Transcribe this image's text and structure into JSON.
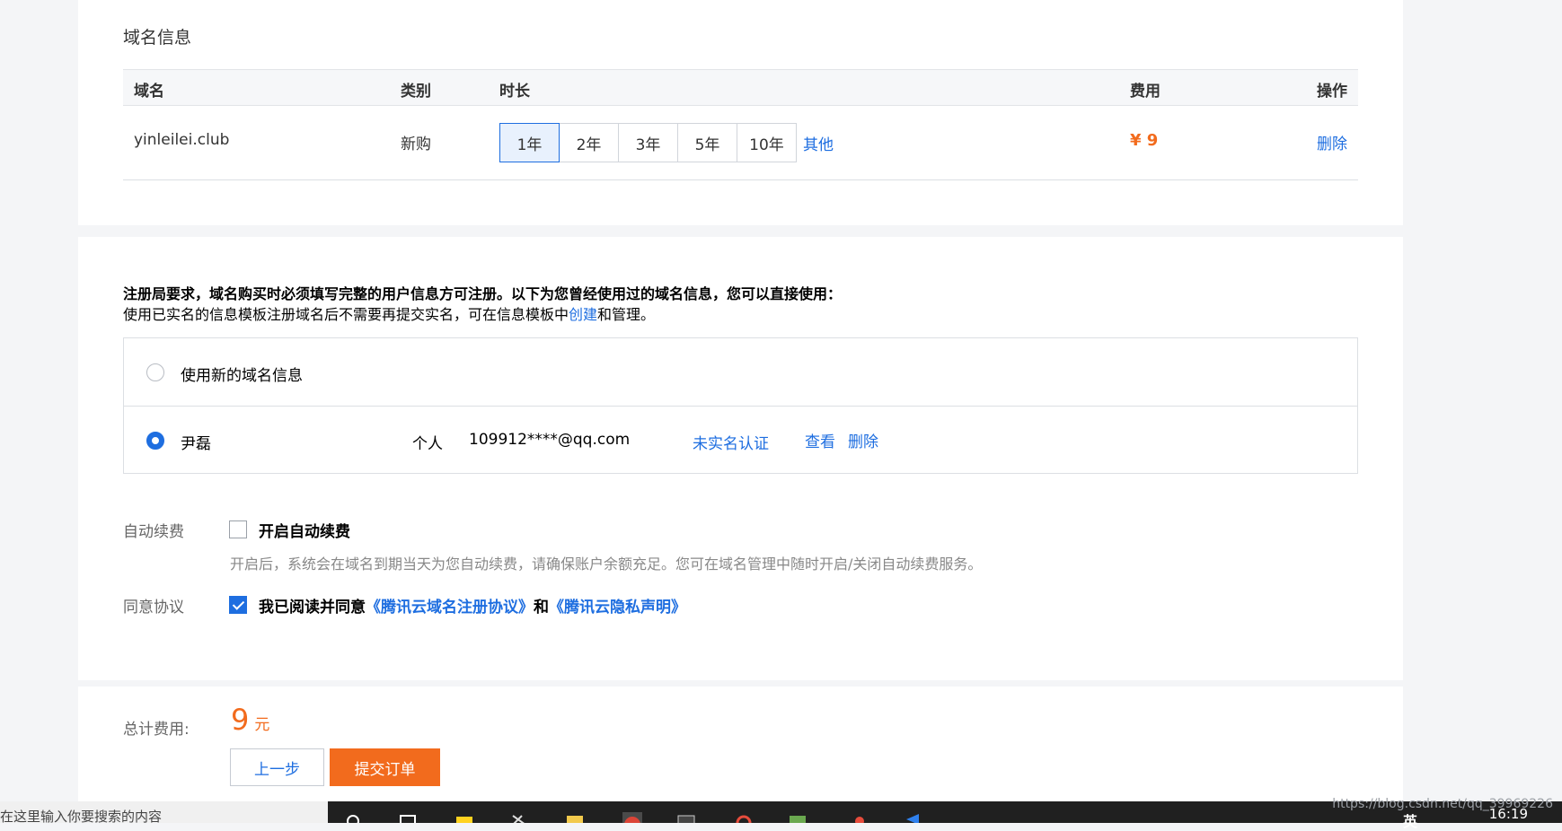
{
  "domain_section": {
    "title": "域名信息",
    "headers": {
      "domain": "域名",
      "type": "类别",
      "duration": "时长",
      "fee": "费用",
      "action": "操作"
    },
    "row": {
      "domain": "yinleilei.club",
      "type": "新购",
      "durations": [
        "1年",
        "2年",
        "3年",
        "5年",
        "10年"
      ],
      "selected_duration": "1年",
      "other": "其他",
      "fee": "¥ 9",
      "delete": "删除"
    }
  },
  "registrant_section": {
    "notice_bold": "注册局要求，域名购买时必须填写完整的用户信息方可注册。以下为您曾经使用过的域名信息，您可以直接使用：",
    "notice_prefix": "使用已实名的信息模板注册域名后不需要再提交实名，可在信息模板中",
    "notice_link": "创建",
    "notice_suffix": "和管理。",
    "new_option": "使用新的域名信息",
    "template": {
      "name": "尹磊",
      "kind": "个人",
      "email": "109912****@qq.com",
      "status": "未实名认证",
      "view": "查看",
      "delete": "删除"
    },
    "selected": "template"
  },
  "auto_renew": {
    "label": "自动续费",
    "checkbox_text": "开启自动续费",
    "checked": false,
    "description": "开启后，系统会在域名到期当天为您自动续费，请确保账户余额充足。您可在域名管理中随时开启/关闭自动续费服务。"
  },
  "agreement": {
    "label": "同意协议",
    "checked": true,
    "text": "我已阅读并同意",
    "link1": "《腾讯云域名注册协议》",
    "and": "和",
    "link2": "《腾讯云隐私声明》"
  },
  "total": {
    "label": "总计费用:",
    "amount": "9",
    "unit": "元",
    "prev_button": "上一步",
    "submit_button": "提交订单"
  },
  "taskbar": {
    "search_text": "在这里输入你要搜索的内容",
    "language": "英",
    "clock": "16:19",
    "watermark": "https://blog.csdn.net/qq_39969226"
  },
  "colors": {
    "accent": "#1e6ee0",
    "price": "#f26b1d",
    "background": "#f4f5f7"
  }
}
